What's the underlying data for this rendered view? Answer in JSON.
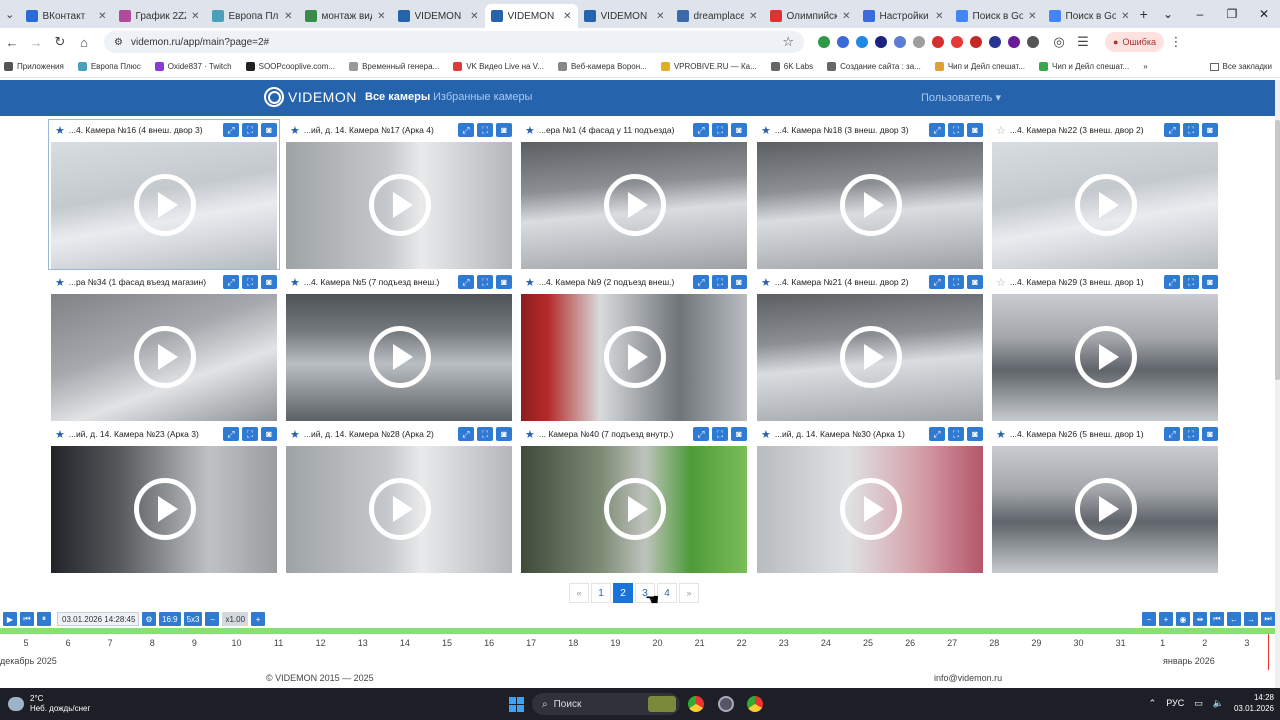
{
  "browser": {
    "tabs": [
      {
        "title": "ВКонтакт",
        "color": "#2a6ad6"
      },
      {
        "title": "График 2ZZ",
        "color": "#b04a9c"
      },
      {
        "title": "Европа Плюс",
        "color": "#4aa0b8"
      },
      {
        "title": "монтаж видео",
        "color": "#3a8a4a"
      },
      {
        "title": "VIDEMON",
        "color": "#2563ad"
      },
      {
        "title": "VIDEMON",
        "color": "#2563ad"
      },
      {
        "title": "VIDEMON",
        "color": "#2563ad"
      },
      {
        "title": "dreamplace",
        "color": "#3a6aa8"
      },
      {
        "title": "Олимпийский",
        "color": "#d33"
      },
      {
        "title": "Настройки",
        "color": "#3a6ae0"
      },
      {
        "title": "Поиск в Goo",
        "color": "#4285f4"
      },
      {
        "title": "Поиск в Goo",
        "color": "#4285f4"
      }
    ],
    "active_tab_index": 5,
    "url": "videmon.ru/app/main?page=2#",
    "error_label": "Ошибка",
    "bookmarks": [
      {
        "label": "Приложения",
        "color": "#555"
      },
      {
        "label": "Европа Плюс",
        "color": "#4aa0b8"
      },
      {
        "label": "Oxide837 · Twitch",
        "color": "#8a3ad6"
      },
      {
        "label": "SOOPcooplive.com...",
        "color": "#222"
      },
      {
        "label": "Временный генера...",
        "color": "#999"
      },
      {
        "label": "VK Видео Live на V...",
        "color": "#e03a3a"
      },
      {
        "label": "Веб-камера Ворон...",
        "color": "#888"
      },
      {
        "label": "VPROBIVE.RU — Ка...",
        "color": "#e0b020"
      },
      {
        "label": "6K Labs",
        "color": "#666"
      },
      {
        "label": "Создание сайта : за...",
        "color": "#666"
      },
      {
        "label": "Чип и Дейл спешат...",
        "color": "#e0a030"
      },
      {
        "label": "Чип и Дейл спешат...",
        "color": "#3aa84a"
      }
    ],
    "all_bookmarks_label": "Все закладки"
  },
  "app": {
    "logo": "VIDEMON",
    "nav_all": "Все камеры",
    "nav_favorites": "Избранные камеры",
    "user_menu": "Пользователь ▾"
  },
  "cameras": [
    {
      "title": "...4. Камера №16 (4 внеш. двор 3)",
      "fav": true,
      "scene": "scene-snow",
      "selected": true
    },
    {
      "title": "...ий, д. 14. Камера №17 (Арка 4)",
      "fav": true,
      "scene": "scene-wall",
      "selected": false
    },
    {
      "title": "...ера №1 (4 фасад у 11 подъезда)",
      "fav": true,
      "scene": "scene-yard",
      "selected": false
    },
    {
      "title": "...4. Камера №18 (3 внеш. двор 3)",
      "fav": true,
      "scene": "scene-yard",
      "selected": false
    },
    {
      "title": "...4. Камера №22 (3 внеш. двор 2)",
      "fav": false,
      "scene": "scene-snow",
      "selected": false
    },
    {
      "title": "...ра №34 (1 фасад въезд магазин)",
      "fav": true,
      "scene": "scene-road",
      "selected": false
    },
    {
      "title": "...4. Камера №5 (7 подъезд внеш.)",
      "fav": true,
      "scene": "scene-parking",
      "selected": false
    },
    {
      "title": "...4. Камера №9 (2 подъезд внеш.)",
      "fav": true,
      "scene": "scene-red",
      "selected": false
    },
    {
      "title": "...4. Камера №21 (4 внеш. двор 2)",
      "fav": true,
      "scene": "scene-yard",
      "selected": false
    },
    {
      "title": "...4. Камера №29 (3 внеш. двор 1)",
      "fav": false,
      "scene": "scene-city",
      "selected": false
    },
    {
      "title": "...ий, д. 14. Камера №23 (Арка 3)",
      "fav": true,
      "scene": "scene-dark",
      "selected": false
    },
    {
      "title": "...ий, д. 14. Камера №28 (Арка 2)",
      "fav": true,
      "scene": "scene-wall",
      "selected": false
    },
    {
      "title": "... Камера №40 (7 подъезд внутр.)",
      "fav": true,
      "scene": "scene-hall",
      "selected": false
    },
    {
      "title": "...ий, д. 14. Камера №30 (Арка 1)",
      "fav": true,
      "scene": "scene-pink",
      "selected": false
    },
    {
      "title": "...4. Камера №26 (5 внеш. двор 1)",
      "fav": true,
      "scene": "scene-city",
      "selected": false
    }
  ],
  "pagination": {
    "prev": "«",
    "pages": [
      "1",
      "2",
      "3",
      "4"
    ],
    "active": "2",
    "next": "»"
  },
  "timeline": {
    "datetime": "03.01.2026 14:28:45",
    "aspect": "16:9",
    "layout": "5x3",
    "speed": "x1.00",
    "days": [
      "5",
      "6",
      "7",
      "8",
      "9",
      "10",
      "11",
      "12",
      "13",
      "14",
      "15",
      "16",
      "17",
      "18",
      "19",
      "20",
      "21",
      "22",
      "23",
      "24",
      "25",
      "26",
      "27",
      "28",
      "29",
      "30",
      "31",
      "1",
      "2",
      "3"
    ],
    "month_left": "декабрь 2025",
    "month_right": "январь 2026"
  },
  "footer": {
    "copyright": "© VIDEMON 2015 — 2025",
    "email": "info@videmon.ru"
  },
  "taskbar": {
    "temp": "2°C",
    "weather": "Неб. дождь/снег",
    "search": "Поиск",
    "lang": "РУС",
    "time": "14:28",
    "date": "03.01.2026"
  }
}
